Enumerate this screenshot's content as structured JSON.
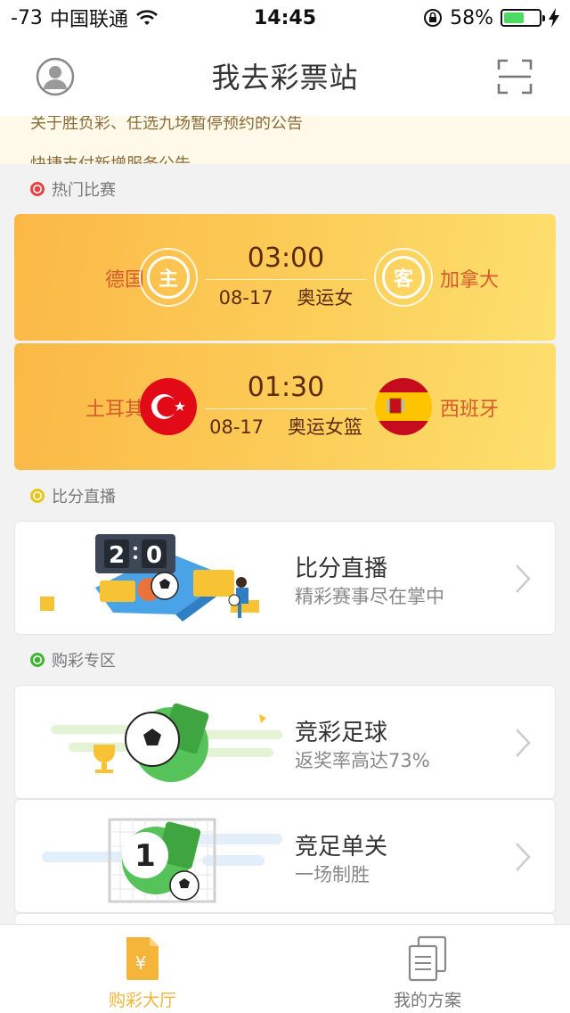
{
  "status_bar": {
    "signal": "-73",
    "carrier": "中国联通",
    "time": "14:45",
    "battery_percent": "58%",
    "battery_level": 0.58
  },
  "nav": {
    "title": "我去彩票站",
    "left_icon": "user-avatar-icon",
    "right_icon": "scan-icon"
  },
  "notice": {
    "line1": "关于胜负彩、任选九场暂停预约的公告",
    "line2": "快捷支付新增服务公告"
  },
  "hot": {
    "title": "热门比赛",
    "matches": [
      {
        "home": "德国",
        "away": "加拿大",
        "home_badge": "主",
        "away_badge": "客",
        "time": "03:00",
        "date": "08-17",
        "league": "奥运女"
      },
      {
        "home": "土耳其",
        "away": "西班牙",
        "home_badge": "",
        "away_badge": "",
        "time": "01:30",
        "date": "08-17",
        "league": "奥运女篮"
      }
    ]
  },
  "live": {
    "title": "比分直播",
    "card_title": "比分直播",
    "card_sub": "精彩赛事尽在掌中",
    "score_left": "2",
    "score_right": "0"
  },
  "buy": {
    "title": "购彩专区",
    "items": [
      {
        "title": "竞彩足球",
        "sub": "返奖率高达73%"
      },
      {
        "title": "竞足单关",
        "sub": "一场制胜",
        "badge": "1"
      }
    ]
  },
  "tabs": [
    {
      "label": "购彩大厅",
      "icon": "lottery-ticket-icon",
      "active": true
    },
    {
      "label": "我的方案",
      "icon": "documents-icon",
      "active": false
    }
  ],
  "colors": {
    "accent": "#f4b53a",
    "card_gradient_start": "#fbb845",
    "card_gradient_end": "#fde06e",
    "team_text": "#d65a2c",
    "match_text": "#5b2b0a"
  }
}
